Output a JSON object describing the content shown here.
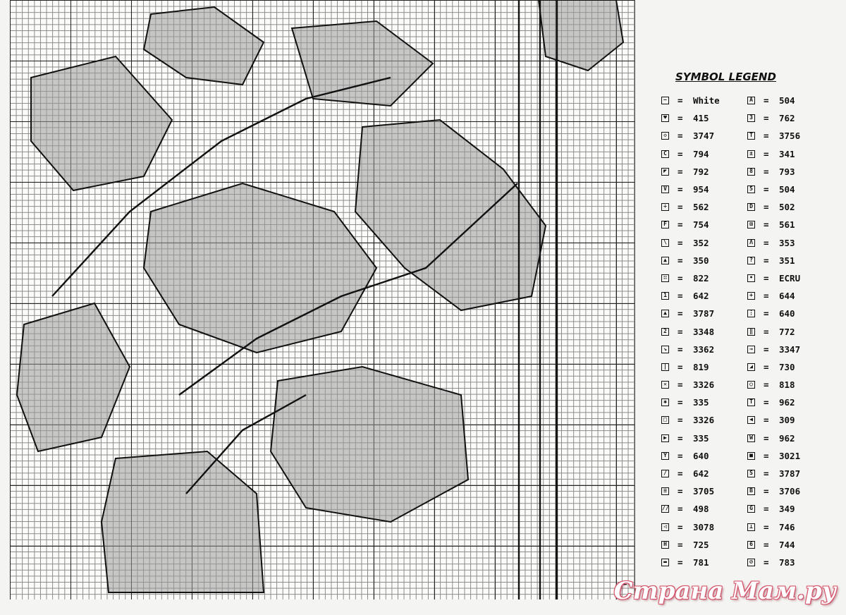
{
  "legend": {
    "title": "SYMBOL LEGEND",
    "left": [
      {
        "icon": "dash-symbol",
        "glyph": "−",
        "eq": "=",
        "code": "White"
      },
      {
        "icon": "heart-symbol",
        "glyph": "♥",
        "eq": "=",
        "code": "415"
      },
      {
        "icon": "diamond-symbol",
        "glyph": "◇",
        "eq": "=",
        "code": "3747"
      },
      {
        "icon": "letter-c-symbol",
        "glyph": "C",
        "eq": "=",
        "code": "794"
      },
      {
        "icon": "half-fill-symbol",
        "glyph": "◤",
        "eq": "=",
        "code": "792"
      },
      {
        "icon": "letter-v-symbol",
        "glyph": "V",
        "eq": "=",
        "code": "954"
      },
      {
        "icon": "divide-symbol",
        "glyph": "÷",
        "eq": "=",
        "code": "562"
      },
      {
        "icon": "letter-f-symbol",
        "glyph": "F",
        "eq": "=",
        "code": "754"
      },
      {
        "icon": "backslash-symbol",
        "glyph": "\\",
        "eq": "=",
        "code": "352"
      },
      {
        "icon": "dome-symbol",
        "glyph": "▲",
        "eq": "=",
        "code": "350"
      },
      {
        "icon": "four-dots-symbol",
        "glyph": "∷",
        "eq": "=",
        "code": "822"
      },
      {
        "icon": "number-1-symbol",
        "glyph": "1",
        "eq": "=",
        "code": "642"
      },
      {
        "icon": "triangle-symbol",
        "glyph": "▲",
        "eq": "=",
        "code": "3787"
      },
      {
        "icon": "number-2-symbol",
        "glyph": "2",
        "eq": "=",
        "code": "3348"
      },
      {
        "icon": "arrow-diagonal-symbol",
        "glyph": "↘",
        "eq": "=",
        "code": "3362"
      },
      {
        "icon": "bar-symbol",
        "glyph": "|",
        "eq": "=",
        "code": "819"
      },
      {
        "icon": "x-box-symbol",
        "glyph": "✕",
        "eq": "=",
        "code": "3326"
      },
      {
        "icon": "asterisk-symbol",
        "glyph": "✱",
        "eq": "=",
        "code": "335"
      },
      {
        "icon": "square-symbol",
        "glyph": "□",
        "eq": "=",
        "code": "3326"
      },
      {
        "icon": "play-symbol",
        "glyph": "▶",
        "eq": "=",
        "code": "335"
      },
      {
        "icon": "letter-y-symbol",
        "glyph": "Y",
        "eq": "=",
        "code": "640"
      },
      {
        "icon": "slash-symbol",
        "glyph": "/",
        "eq": "=",
        "code": "642"
      },
      {
        "icon": "equals-symbol",
        "glyph": "≡",
        "eq": "=",
        "code": "3705"
      },
      {
        "icon": "double-slash-symbol",
        "glyph": "//",
        "eq": "=",
        "code": "498"
      },
      {
        "icon": "left-triangle-symbol",
        "glyph": "◁",
        "eq": "=",
        "code": "3078"
      },
      {
        "icon": "letter-h-symbol",
        "glyph": "H",
        "eq": "=",
        "code": "725"
      },
      {
        "icon": "bar-filled-symbol",
        "glyph": "▬",
        "eq": "=",
        "code": "781"
      }
    ],
    "right": [
      {
        "icon": "letter-a-symbol",
        "glyph": "A",
        "eq": "=",
        "code": "504"
      },
      {
        "icon": "number-3-symbol",
        "glyph": "3",
        "eq": "=",
        "code": "762"
      },
      {
        "icon": "letter-t-symbol",
        "glyph": "T",
        "eq": "=",
        "code": "3756"
      },
      {
        "icon": "plus-minus-symbol",
        "glyph": "±",
        "eq": "=",
        "code": "341"
      },
      {
        "icon": "number-8-symbol",
        "glyph": "8",
        "eq": "=",
        "code": "793"
      },
      {
        "icon": "number-5-symbol",
        "glyph": "5",
        "eq": "=",
        "code": "504"
      },
      {
        "icon": "letter-d-symbol",
        "glyph": "D",
        "eq": "=",
        "code": "502"
      },
      {
        "icon": "crossed-box-symbol",
        "glyph": "⊠",
        "eq": "=",
        "code": "561"
      },
      {
        "icon": "caret-symbol",
        "glyph": "Λ",
        "eq": "=",
        "code": "353"
      },
      {
        "icon": "question-symbol",
        "glyph": "?",
        "eq": "=",
        "code": "351"
      },
      {
        "icon": "dot-symbol",
        "glyph": "•",
        "eq": "=",
        "code": "ECRU"
      },
      {
        "icon": "cross-symbol",
        "glyph": "+",
        "eq": "=",
        "code": "644"
      },
      {
        "icon": "split-symbol",
        "glyph": "⋮",
        "eq": "=",
        "code": "640"
      },
      {
        "icon": "double-bar-symbol",
        "glyph": "‖",
        "eq": "=",
        "code": "772"
      },
      {
        "icon": "arrow-right-symbol",
        "glyph": "→",
        "eq": "=",
        "code": "3347"
      },
      {
        "icon": "corner-fill-symbol",
        "glyph": "◢",
        "eq": "=",
        "code": "730"
      },
      {
        "icon": "circle-symbol",
        "glyph": "○",
        "eq": "=",
        "code": "818"
      },
      {
        "icon": "letter-t-filled-symbol",
        "glyph": "T",
        "eq": "=",
        "code": "962"
      },
      {
        "icon": "left-filled-triangle-symbol",
        "glyph": "◀",
        "eq": "=",
        "code": "309"
      },
      {
        "icon": "letter-w-symbol",
        "glyph": "W",
        "eq": "=",
        "code": "962"
      },
      {
        "icon": "filled-square-symbol",
        "glyph": "■",
        "eq": "=",
        "code": "3021"
      },
      {
        "icon": "letter-s-symbol",
        "glyph": "S",
        "eq": "=",
        "code": "3787"
      },
      {
        "icon": "letter-b-symbol",
        "glyph": "B",
        "eq": "=",
        "code": "3706"
      },
      {
        "icon": "letter-g-symbol",
        "glyph": "G",
        "eq": "=",
        "code": "349"
      },
      {
        "icon": "inverted-t-symbol",
        "glyph": "⊥",
        "eq": "=",
        "code": "746"
      },
      {
        "icon": "number-6-symbol",
        "glyph": "6",
        "eq": "=",
        "code": "744"
      },
      {
        "icon": "circled-slash-symbol",
        "glyph": "⊘",
        "eq": "=",
        "code": "783"
      }
    ]
  },
  "edge_marker": "←",
  "watermark": "Страна Мам.ру"
}
